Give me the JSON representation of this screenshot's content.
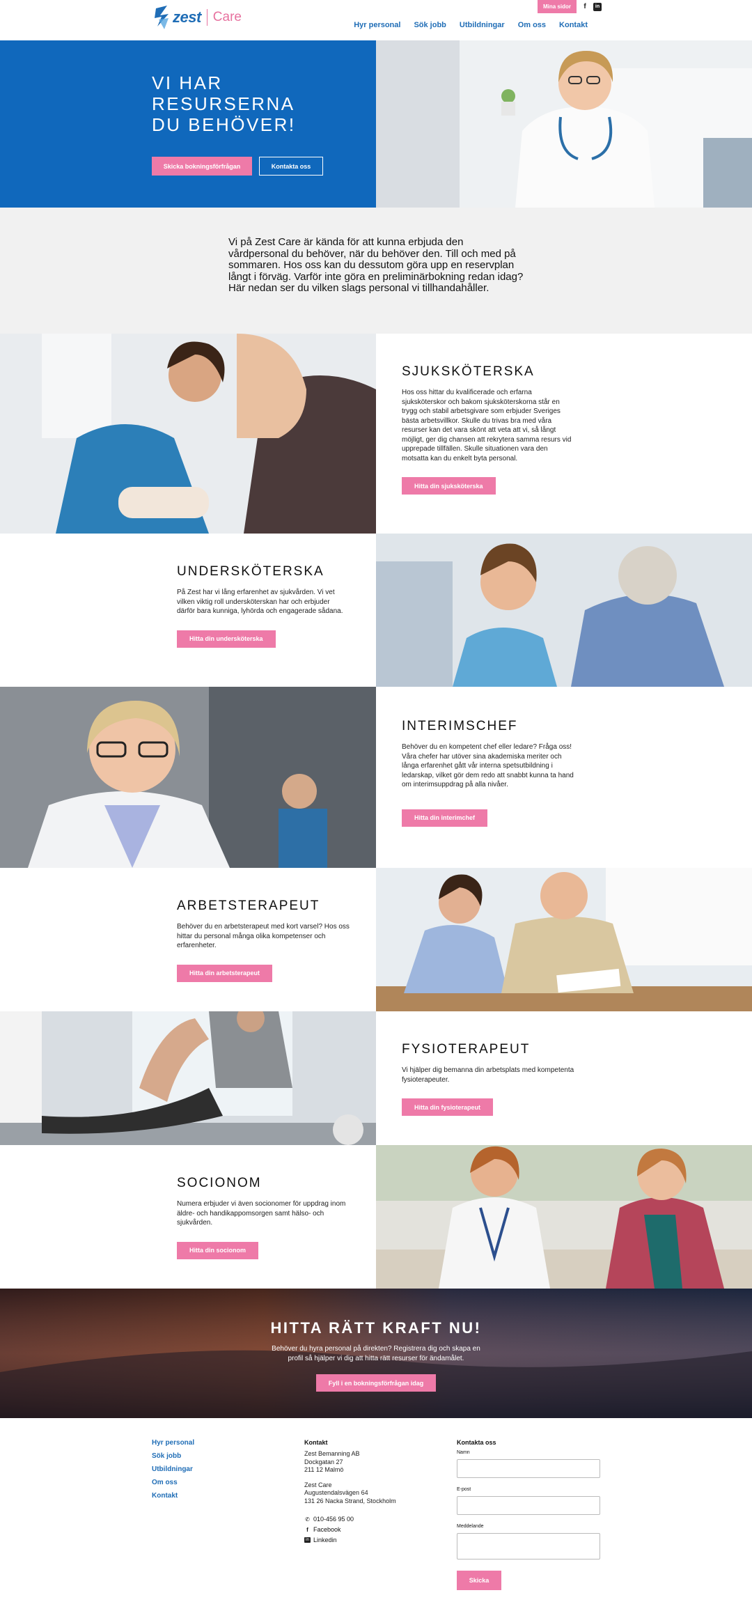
{
  "header": {
    "logo_word": "zest",
    "logo_care": "Care",
    "mina_sidor": "Mina sidor",
    "facebook_glyph": "f",
    "linkedin_glyph": "in",
    "nav": [
      "Hyr personal",
      "Sök jobb",
      "Utbildningar",
      "Om oss",
      "Kontakt"
    ]
  },
  "hero": {
    "title": "VI HAR RESURSERNA DU BEHÖVER!",
    "btn_primary": "Skicka bokningsförfrågan",
    "btn_secondary": "Kontakta oss"
  },
  "intro": {
    "text": "Vi på Zest Care är kända för att kunna erbjuda den vårdpersonal du behöver, när du behöver den. Till och med på sommaren. Hos oss kan du dessutom göra upp en reservplan långt i förväg. Varför inte göra en preliminärbokning redan idag? Här nedan ser du vilken slags personal vi tillhandahåller."
  },
  "professions": [
    {
      "title": "SJUKSKÖTERSKA",
      "desc": "Hos oss hittar du kvalificerade och erfarna sjuksköterskor och bakom sjuksköterskorna står en trygg och stabil arbetsgivare som erbjuder Sveriges bästa arbetsvillkor. Skulle du trivas bra med våra resurser kan det vara skönt att veta att vi, så långt möjligt, ger dig chansen att rekrytera samma resurs vid upprepade tillfällen. Skulle situationen vara den motsatta kan du enkelt byta personal.",
      "btn": "Hitta din sjuksköterska"
    },
    {
      "title": "UNDERSKÖTERSKA",
      "desc": "På Zest har vi lång erfarenhet av sjukvården. Vi vet vilken viktig roll undersköterskan har och erbjuder därför bara kunniga, lyhörda och engagerade sådana.",
      "btn": "Hitta din undersköterska"
    },
    {
      "title": "INTERIMSCHEF",
      "desc": "Behöver du en kompetent chef eller ledare? Fråga oss! Våra chefer har utöver sina akademiska meriter och långa erfarenhet gått vår interna spetsutbildning i ledarskap, vilket gör dem redo att snabbt kunna ta hand om interimsuppdrag på alla nivåer.",
      "btn": "Hitta din interimchef"
    },
    {
      "title": "ARBETSTERAPEUT",
      "desc": "Behöver du en arbetsterapeut med kort varsel? Hos oss hittar du personal många olika kompetenser och erfarenheter.",
      "btn": "Hitta din arbetsterapeut"
    },
    {
      "title": "FYSIOTERAPEUT",
      "desc": "Vi hjälper dig bemanna din arbetsplats med kompetenta fysioterapeuter.",
      "btn": "Hitta din fysioterapeut"
    },
    {
      "title": "SOCIONOM",
      "desc": "Numera erbjuder vi även socionomer för uppdrag inom äldre- och handikappomsorgen samt hälso- och sjukvården.",
      "btn": "Hitta din socionom"
    }
  ],
  "cta": {
    "title": "HITTA RÄTT KRAFT NU!",
    "sub": "Behöver du hyra personal på direkten? Registrera dig och skapa en profil så hjälper vi dig att hitta rätt resurser för ändamålet.",
    "btn": "Fyll i en bokningsförfrågan idag"
  },
  "footer": {
    "nav": [
      "Hyr personal",
      "Sök jobb",
      "Utbildningar",
      "Om oss",
      "Kontakt"
    ],
    "contact_heading": "Kontakt",
    "address1": [
      "Zest Bemanning AB",
      "Dockgatan 27",
      "211 12 Malmö"
    ],
    "address2": [
      "Zest Care",
      "Augustendalsvägen 64",
      "131 26 Nacka Strand, Stockholm"
    ],
    "phone": "010-456 95 00",
    "facebook": "Facebook",
    "linkedin": "Linkedin",
    "facebook_glyph": "f",
    "linkedin_glyph": "in",
    "form_heading": "Kontakta oss",
    "label_name": "Namn",
    "label_email": "E-post",
    "label_message": "Meddelande",
    "submit": "Skicka"
  },
  "colors": {
    "brand_blue": "#1068bc",
    "link_blue": "#1f6db6",
    "accent_pink": "#ee7aa8",
    "intro_bg": "#f1f1f1"
  }
}
